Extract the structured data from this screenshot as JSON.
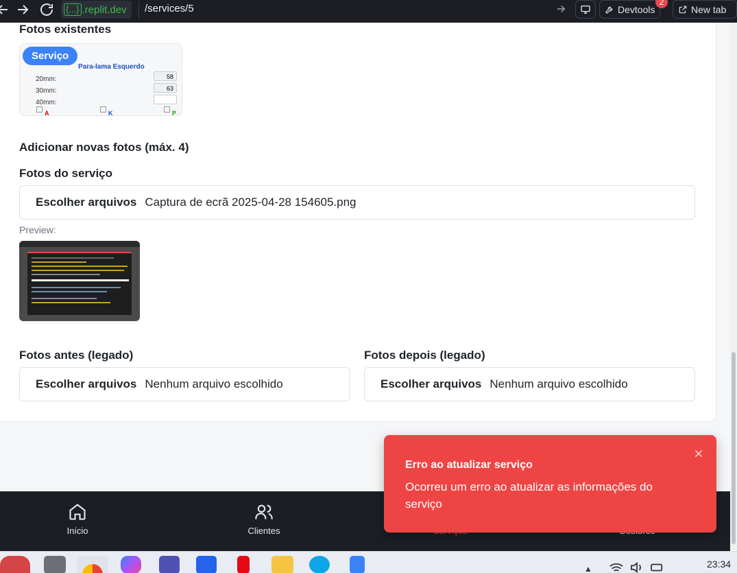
{
  "browser": {
    "url_prefix": "{...}",
    "url_domain": ".replit.dev",
    "url_path": "/services/5",
    "devtools_label": "Devtools",
    "devtools_badge": "2",
    "newtab_label": "New tab"
  },
  "page": {
    "existing_photos_heading": "Fotos existentes",
    "existing_photo": {
      "tag": "Serviço",
      "form_title": "Para-lama Esquerdo",
      "rows": [
        {
          "label": "20mm:",
          "value": "58"
        },
        {
          "label": "30mm:",
          "value": "63"
        },
        {
          "label": "40mm:",
          "value": ""
        }
      ],
      "checks": [
        "A",
        "K",
        "P"
      ]
    },
    "add_photos_heading": "Adicionar novas fotos (máx. 4)",
    "service_photos_heading": "Fotos do serviço",
    "service_file": {
      "button": "Escolher arquivos",
      "value": "Captura de ecrã 2025-04-28 154605.png"
    },
    "preview_label": "Preview:",
    "before_heading": "Fotos antes (legado)",
    "before_file": {
      "button": "Escolher arquivos",
      "value": "Nenhum arquivo escolhido"
    },
    "after_heading": "Fotos depois (legado)",
    "after_file": {
      "button": "Escolher arquivos",
      "value": "Nenhum arquivo escolhido"
    }
  },
  "bottom_nav": {
    "items": [
      {
        "label": "Início",
        "icon": "home-icon"
      },
      {
        "label": "Clientes",
        "icon": "users-icon"
      },
      {
        "label": "Serviços",
        "icon": "wrench-icon",
        "active": true
      },
      {
        "label": "Gestores",
        "icon": "user-cog-icon"
      }
    ]
  },
  "toast": {
    "title": "Erro ao atualizar serviço",
    "description": "Ocorreu um erro ao atualizar as informações do serviço",
    "color": "#ef4444"
  },
  "taskbar": {
    "time": "23:34"
  }
}
